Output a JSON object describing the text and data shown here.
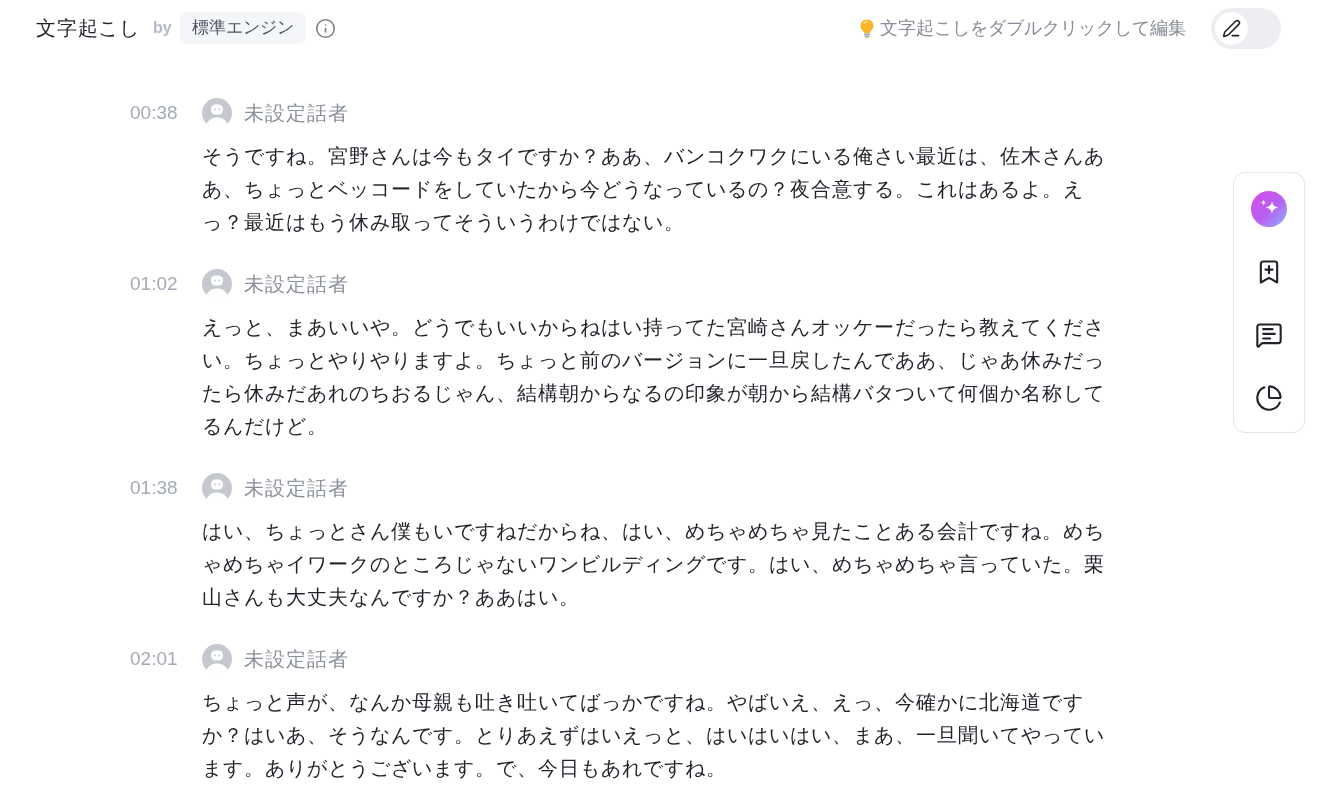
{
  "header": {
    "title": "文字起こし",
    "by": "by",
    "engine": "標準エンジン",
    "hint": "文字起こしをダブルクリックして編集",
    "edit_toggle": {
      "on": false
    }
  },
  "segments": [
    {
      "time": "00:38",
      "speaker": "未設定話者",
      "text": "そうですね。宮野さんは今もタイですか？ああ、バンコクワクにいる俺さい最近は、佐木さんああ、ちょっとベッコードをしていたから今どうなっているの？夜合意する。これはあるよ。えっ？最近はもう休み取ってそういうわけではない。"
    },
    {
      "time": "01:02",
      "speaker": "未設定話者",
      "text": "えっと、まあいいや。どうでもいいからねはい持ってた宮崎さんオッケーだったら教えてください。ちょっとやりやりますよ。ちょっと前のバージョンに一旦戻したんでああ、じゃあ休みだったら休みだあれのちおるじゃん、結構朝からなるの印象が朝から結構バタついて何個か名称してるんだけど。"
    },
    {
      "time": "01:38",
      "speaker": "未設定話者",
      "text": "はい、ちょっとさん僕もいですねだからね、はい、めちゃめちゃ見たことある会計ですね。めちゃめちゃイワークのところじゃないワンビルディングです。はい、めちゃめちゃ言っていた。栗山さんも大丈夫なんですか？ああはい。"
    },
    {
      "time": "02:01",
      "speaker": "未設定話者",
      "text": "ちょっと声が、なんか母親も吐き吐いてばっかですね。やばいえ、えっ、今確かに北海道ですか？はいあ、そうなんです。とりあえずはいえっと、はいはいはい、まあ、一旦聞いてやっています。ありがとうございます。で、今日もあれですね。"
    }
  ]
}
